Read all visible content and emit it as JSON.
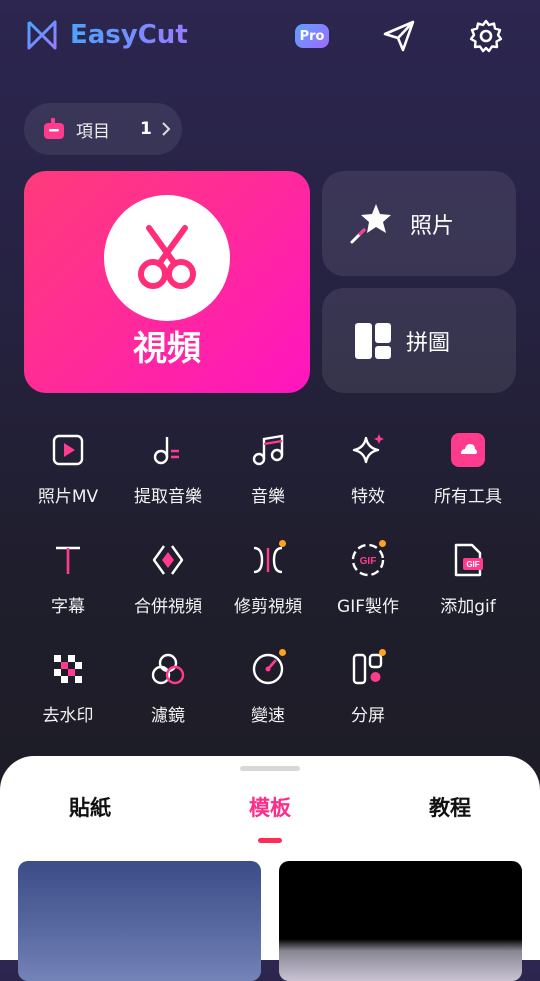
{
  "app": {
    "name": "EasyCut",
    "pro_badge": "Pro"
  },
  "project": {
    "label": "項目",
    "count": "1"
  },
  "main_cards": {
    "video_label": "視頻",
    "photo_label": "照片",
    "collage_label": "拼圖"
  },
  "tools": [
    {
      "label": "照片MV",
      "icon": "photo-mv-icon",
      "new": false
    },
    {
      "label": "提取音樂",
      "icon": "extract-music-icon",
      "new": false
    },
    {
      "label": "音樂",
      "icon": "music-icon",
      "new": false
    },
    {
      "label": "特效",
      "icon": "effects-icon",
      "new": false
    },
    {
      "label": "所有工具",
      "icon": "all-tools-icon",
      "new": false
    },
    {
      "label": "字幕",
      "icon": "text-icon",
      "new": false
    },
    {
      "label": "合併視頻",
      "icon": "merge-icon",
      "new": false
    },
    {
      "label": "修剪視頻",
      "icon": "trim-icon",
      "new": true
    },
    {
      "label": "GIF製作",
      "icon": "gif-maker-icon",
      "new": true
    },
    {
      "label": "添加gif",
      "icon": "add-gif-icon",
      "new": false
    },
    {
      "label": "去水印",
      "icon": "remove-watermark-icon",
      "new": false
    },
    {
      "label": "濾鏡",
      "icon": "filter-icon",
      "new": false
    },
    {
      "label": "變速",
      "icon": "speed-icon",
      "new": true
    },
    {
      "label": "分屏",
      "icon": "split-screen-icon",
      "new": true
    }
  ],
  "sheet_tabs": [
    {
      "label": "貼紙",
      "active": false
    },
    {
      "label": "模板",
      "active": true
    },
    {
      "label": "教程",
      "active": false
    }
  ],
  "colors": {
    "accent_pink": "#ff2d8a",
    "new_dot": "#ffa21f"
  }
}
